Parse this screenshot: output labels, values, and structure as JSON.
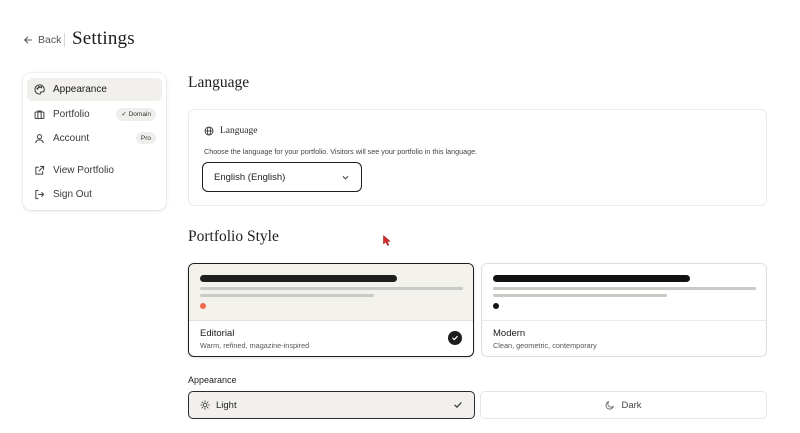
{
  "header": {
    "back_label": "Back",
    "title": "Settings"
  },
  "sidebar": {
    "items": [
      {
        "label": "Appearance",
        "icon": "palette-icon",
        "active": true
      },
      {
        "label": "Portfolio",
        "icon": "briefcase-icon",
        "badge": "✓ Domain"
      },
      {
        "label": "Account",
        "icon": "user-icon",
        "badge": "Pro"
      },
      {
        "label": "View Portfolio",
        "icon": "external-link-icon"
      },
      {
        "label": "Sign Out",
        "icon": "sign-out-icon"
      }
    ]
  },
  "language": {
    "section_title": "Language",
    "card_title": "Language",
    "description": "Choose the language for your portfolio. Visitors will see your portfolio in this language.",
    "selected": "English (English)"
  },
  "portfolio_style": {
    "section_title": "Portfolio Style",
    "options": [
      {
        "name": "Editorial",
        "description": "Warm, refined, magazine-inspired",
        "selected": true,
        "accent": "#ef6a4c"
      },
      {
        "name": "Modern",
        "description": "Clean, geometric, contemporary",
        "selected": false,
        "accent": "#111111"
      }
    ]
  },
  "appearance": {
    "label": "Appearance",
    "options": [
      {
        "label": "Light",
        "icon": "sun-icon",
        "selected": true
      },
      {
        "label": "Dark",
        "icon": "moon-icon",
        "selected": false
      }
    ]
  }
}
